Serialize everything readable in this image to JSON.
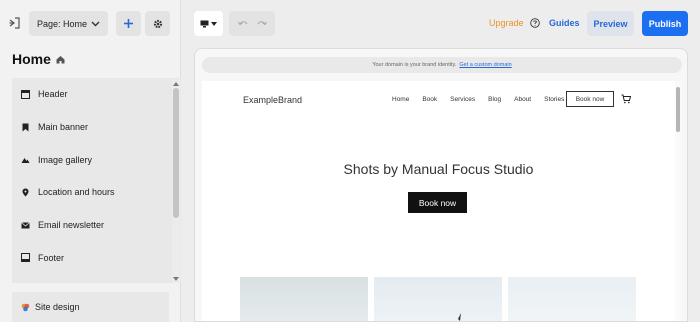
{
  "sidebar": {
    "page_select_label": "Page: Home",
    "page_title": "Home",
    "sections": [
      {
        "label": "Header",
        "icon": "header-icon"
      },
      {
        "label": "Main banner",
        "icon": "bookmark-icon"
      },
      {
        "label": "Image gallery",
        "icon": "mountain-icon"
      },
      {
        "label": "Location and hours",
        "icon": "pin-icon"
      },
      {
        "label": "Email newsletter",
        "icon": "envelope-icon"
      },
      {
        "label": "Footer",
        "icon": "footer-icon"
      }
    ],
    "site_design_label": "Site design"
  },
  "toolbar": {
    "upgrade_label": "Upgrade",
    "guides_label": "Guides",
    "preview_label": "Preview",
    "publish_label": "Publish"
  },
  "preview": {
    "domain_notice": "Your domain is your brand identity.",
    "domain_link": "Get a custom domain",
    "brand": "ExampleBrand",
    "nav": [
      "Home",
      "Book",
      "Services",
      "Blog",
      "About",
      "Stories"
    ],
    "nav_book_button": "Book now",
    "hero_title": "Shots by Manual Focus Studio",
    "hero_button": "Book now"
  },
  "colors": {
    "accent_blue": "#1d6ff2",
    "upgrade_orange": "#e8942a",
    "link_blue": "#2668d8"
  }
}
